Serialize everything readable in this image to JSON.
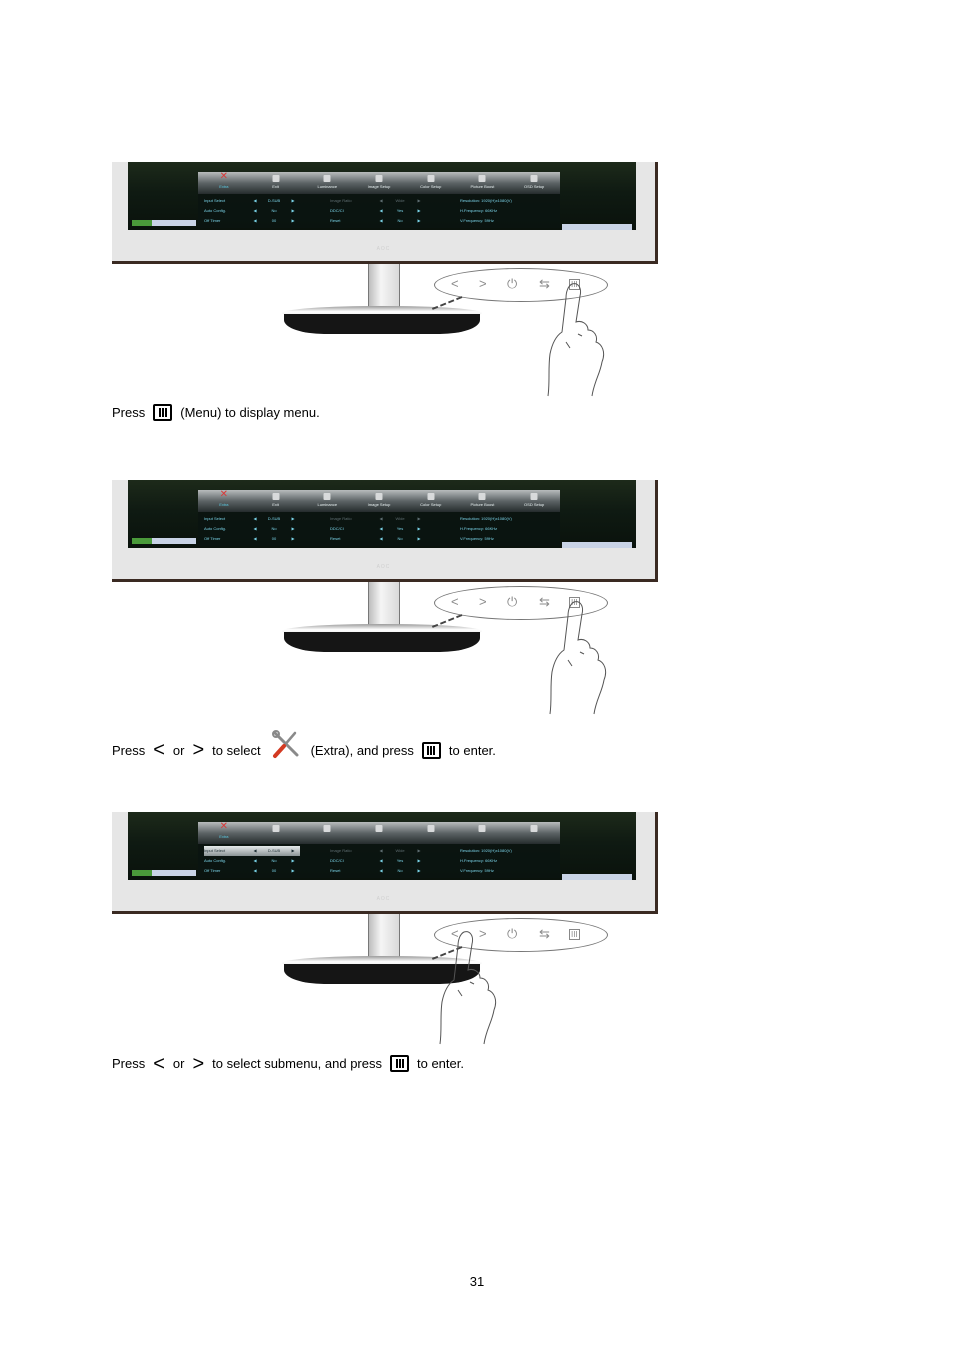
{
  "osd": {
    "tabs": [
      {
        "icon": "extra-icon",
        "label": "Extra"
      },
      {
        "icon": "exit-icon",
        "label": "Exit"
      },
      {
        "icon": "luminance-icon",
        "label": "Luminance"
      },
      {
        "icon": "image-setup-icon",
        "label": "Image Setup"
      },
      {
        "icon": "color-setup-icon",
        "label": "Color Setup"
      },
      {
        "icon": "picture-boost-icon",
        "label": "Picture Boost"
      },
      {
        "icon": "osd-setup-icon",
        "label": "OSD Setup"
      }
    ],
    "left_rows": [
      {
        "label": "Input Select",
        "value": "D-SUB"
      },
      {
        "label": "Auto Config.",
        "value": "No"
      },
      {
        "label": "Off Timer",
        "value": "00"
      }
    ],
    "middle_rows": [
      {
        "label": "Image Ratio",
        "value": "Wide"
      },
      {
        "label": "DDC/CI",
        "value": "Yes"
      },
      {
        "label": "Reset",
        "value": "No"
      }
    ],
    "info_rows": [
      {
        "text": "Resolution: 1920(H)x1080(V)"
      },
      {
        "text": "H.Frequency: 66KHz"
      },
      {
        "text": "V.Frequency: 59Hz"
      }
    ],
    "arrow_left": "◀",
    "arrow_right": "▶",
    "brand": "AOC"
  },
  "buttons": {
    "left": "<",
    "right": ">",
    "power": "⏻",
    "source": "⇆",
    "menu": "III"
  },
  "captions": {
    "step1": {
      "press": "Press",
      "rest": "(Menu) to display menu."
    },
    "step2": {
      "press": "Press",
      "or": "or",
      "to_select": "to select",
      "extra": "(Extra), and press",
      "to_enter": "to enter."
    },
    "step3": {
      "press": "Press",
      "or": "or",
      "to_select": "to select submenu, and press",
      "to_enter": "to enter."
    }
  },
  "chevrons": {
    "left": "<",
    "right": ">"
  },
  "page_number": "31"
}
